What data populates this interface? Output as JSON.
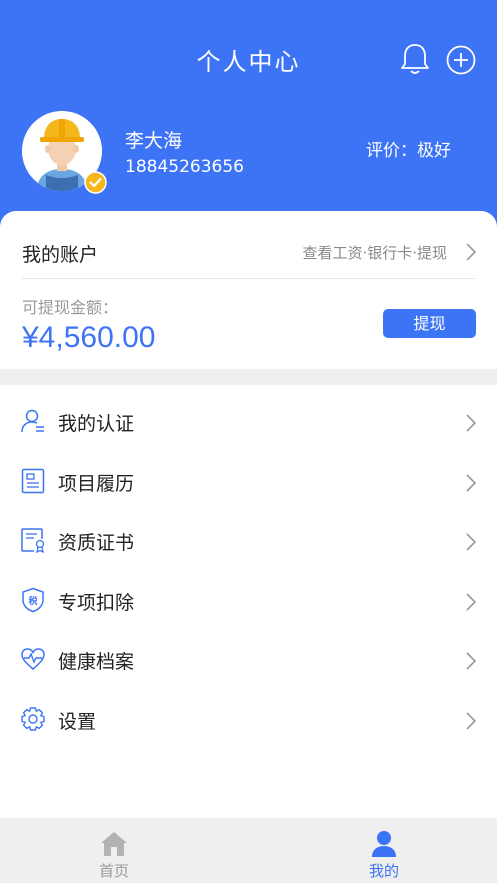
{
  "header": {
    "title": "个人中心",
    "icons": [
      "bell-icon",
      "plus-circle-icon"
    ]
  },
  "profile": {
    "name": "李大海",
    "phone": "18845263656",
    "rating": "评价：极好",
    "avatar_icon": "worker-avatar-icon",
    "badge_icon": "verified-check-icon"
  },
  "account": {
    "title": "我的账户",
    "link": "查看工资·银行卡·提现",
    "balance_label": "可提现金额：",
    "balance_value": "¥4,560.00",
    "withdraw_button": "提现"
  },
  "menu": {
    "items": [
      {
        "label": "我的认证",
        "icon": "user-verify-icon"
      },
      {
        "label": "项目履历",
        "icon": "resume-doc-icon"
      },
      {
        "label": "资质证书",
        "icon": "certificate-icon"
      },
      {
        "label": "专项扣除",
        "icon": "tax-shield-icon"
      },
      {
        "label": "健康档案",
        "icon": "heartbeat-icon"
      },
      {
        "label": "设置",
        "icon": "gear-icon"
      }
    ]
  },
  "tabbar": {
    "tabs": [
      {
        "label": "首页",
        "icon": "home-icon",
        "active": false
      },
      {
        "label": "我的",
        "icon": "person-icon",
        "active": true
      }
    ]
  },
  "colors": {
    "primary": "#3d74f5",
    "tab_inactive": "#999999",
    "helmet": "#f5b81c",
    "badge": "#f5b81c"
  }
}
